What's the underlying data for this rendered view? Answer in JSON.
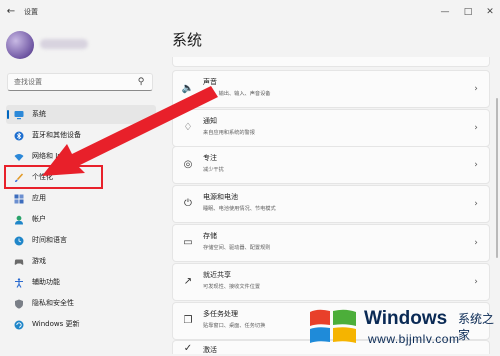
{
  "window": {
    "title": "设置"
  },
  "sidebar": {
    "search_placeholder": "查找设置",
    "items": [
      {
        "label": "系统",
        "selected": true
      },
      {
        "label": "蓝牙和其他设备"
      },
      {
        "label": "网络和 Internet"
      },
      {
        "label": "个性化"
      },
      {
        "label": "应用"
      },
      {
        "label": "帐户"
      },
      {
        "label": "时间和语言"
      },
      {
        "label": "游戏"
      },
      {
        "label": "辅助功能"
      },
      {
        "label": "隐私和安全性"
      },
      {
        "label": "Windows 更新"
      }
    ]
  },
  "main": {
    "title": "系统",
    "cards": [
      {
        "title": "",
        "subtitle": ""
      },
      {
        "title": "声音",
        "subtitle": "音量、输出、输入、声音设备",
        "icon": "speaker-icon"
      },
      {
        "title": "通知",
        "subtitle": "来自应用和系统的警报",
        "icon": "bell-icon"
      },
      {
        "title": "专注",
        "subtitle": "减少干扰",
        "icon": "focus-icon"
      },
      {
        "title": "电源和电池",
        "subtitle": "睡眠、电池使用情况、节电模式",
        "icon": "power-icon"
      },
      {
        "title": "存储",
        "subtitle": "存储空间、驱动器、配置规则",
        "icon": "storage-icon"
      },
      {
        "title": "就近共享",
        "subtitle": "可发现性、接收文件位置",
        "icon": "share-icon"
      },
      {
        "title": "多任务处理",
        "subtitle": "贴靠窗口、桌面、任务切换",
        "icon": "multitask-icon"
      },
      {
        "title": "激活",
        "subtitle": "",
        "icon": "activation-icon"
      }
    ]
  },
  "watermark": {
    "brand": "Windows",
    "sub": "系统之家",
    "url": "www.bjjmlv.com"
  },
  "colors": {
    "accent": "#0067c0",
    "arrow": "#e8202a",
    "highlight_box": "#e8202a"
  }
}
